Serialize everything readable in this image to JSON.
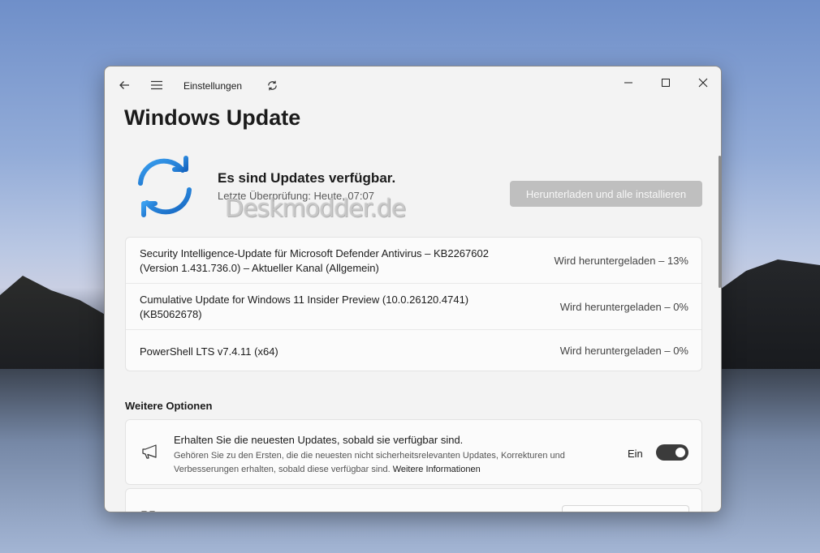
{
  "titlebar": {
    "app_title": "Einstellungen",
    "back_icon": "arrow-left-icon",
    "menu_icon": "hamburger-icon",
    "sync_icon": "sync-icon",
    "minimize_icon": "minimize-icon",
    "maximize_icon": "maximize-icon",
    "close_icon": "close-icon"
  },
  "page": {
    "title": "Windows Update"
  },
  "status": {
    "icon": "sync-arrows-icon",
    "title": "Es sind Updates verfügbar.",
    "subtitle": "Letzte Überprüfung: Heute, 07:07",
    "button_label": "Herunterladen und alle installieren"
  },
  "updates": [
    {
      "name": "Security Intelligence-Update für Microsoft Defender Antivirus – KB2267602 (Version 1.431.736.0) – Aktueller Kanal (Allgemein)",
      "status": "Wird heruntergeladen – 13%"
    },
    {
      "name": "Cumulative Update for Windows 11 Insider Preview (10.0.26120.4741) (KB5062678)",
      "status": "Wird heruntergeladen – 0%"
    },
    {
      "name": "PowerShell LTS v7.4.11 (x64)",
      "status": "Wird heruntergeladen – 0%"
    }
  ],
  "more_options": {
    "heading": "Weitere Optionen",
    "latest_updates": {
      "icon": "megaphone-icon",
      "title": "Erhalten Sie die neuesten Updates, sobald sie verfügbar sind.",
      "description": "Gehören Sie zu den Ersten, die die neuesten nicht sicherheitsrelevanten Updates, Korrekturen und Verbesserungen erhalten, sobald diese verfügbar sind.",
      "link": "Weitere Informationen",
      "toggle_label": "Ein",
      "toggle_on": true
    }
  },
  "watermark": "Deskmodder.de",
  "colors": {
    "accent": "#1a7fd6",
    "toggle_on": "#3b3b3b",
    "button_disabled": "#bfbfbf"
  }
}
